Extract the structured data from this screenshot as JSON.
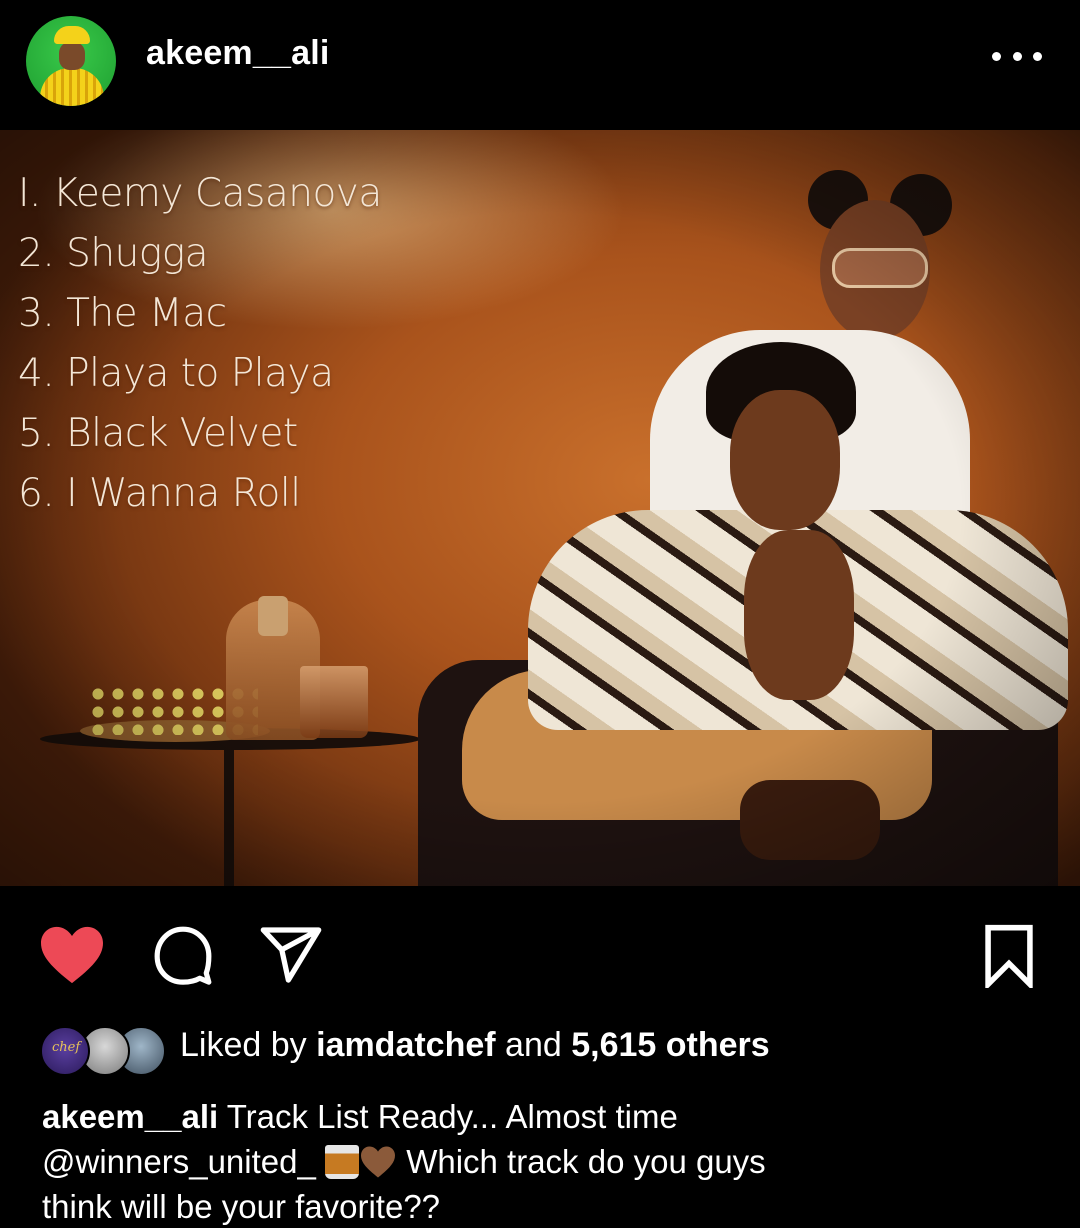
{
  "header": {
    "username": "akeem__ali",
    "avatar_icon": "user-avatar",
    "more_icon": "more-options-icon"
  },
  "post": {
    "tracklist": [
      "I. Keemy Casanova",
      "2. Shugga",
      "3. The Mac",
      "4. Playa to Playa",
      "5. Black Velvet",
      "6. I Wanna Roll"
    ]
  },
  "actions": {
    "like_icon": "heart-filled-icon",
    "comment_icon": "comment-icon",
    "share_icon": "send-icon",
    "save_icon": "bookmark-icon",
    "like_color": "#ed4956"
  },
  "likes": {
    "prefix": "Liked by",
    "user": "iamdatchef",
    "and": "and",
    "count": "5,615 others"
  },
  "caption": {
    "username": "akeem__ali",
    "text1": "Track List Ready... Almost time",
    "mention": "@winners_united_",
    "text2": "Which track do you guys",
    "text3": "think will be your favorite??",
    "emojis": [
      "whiskey-glass-emoji",
      "brown-heart-emoji"
    ]
  }
}
